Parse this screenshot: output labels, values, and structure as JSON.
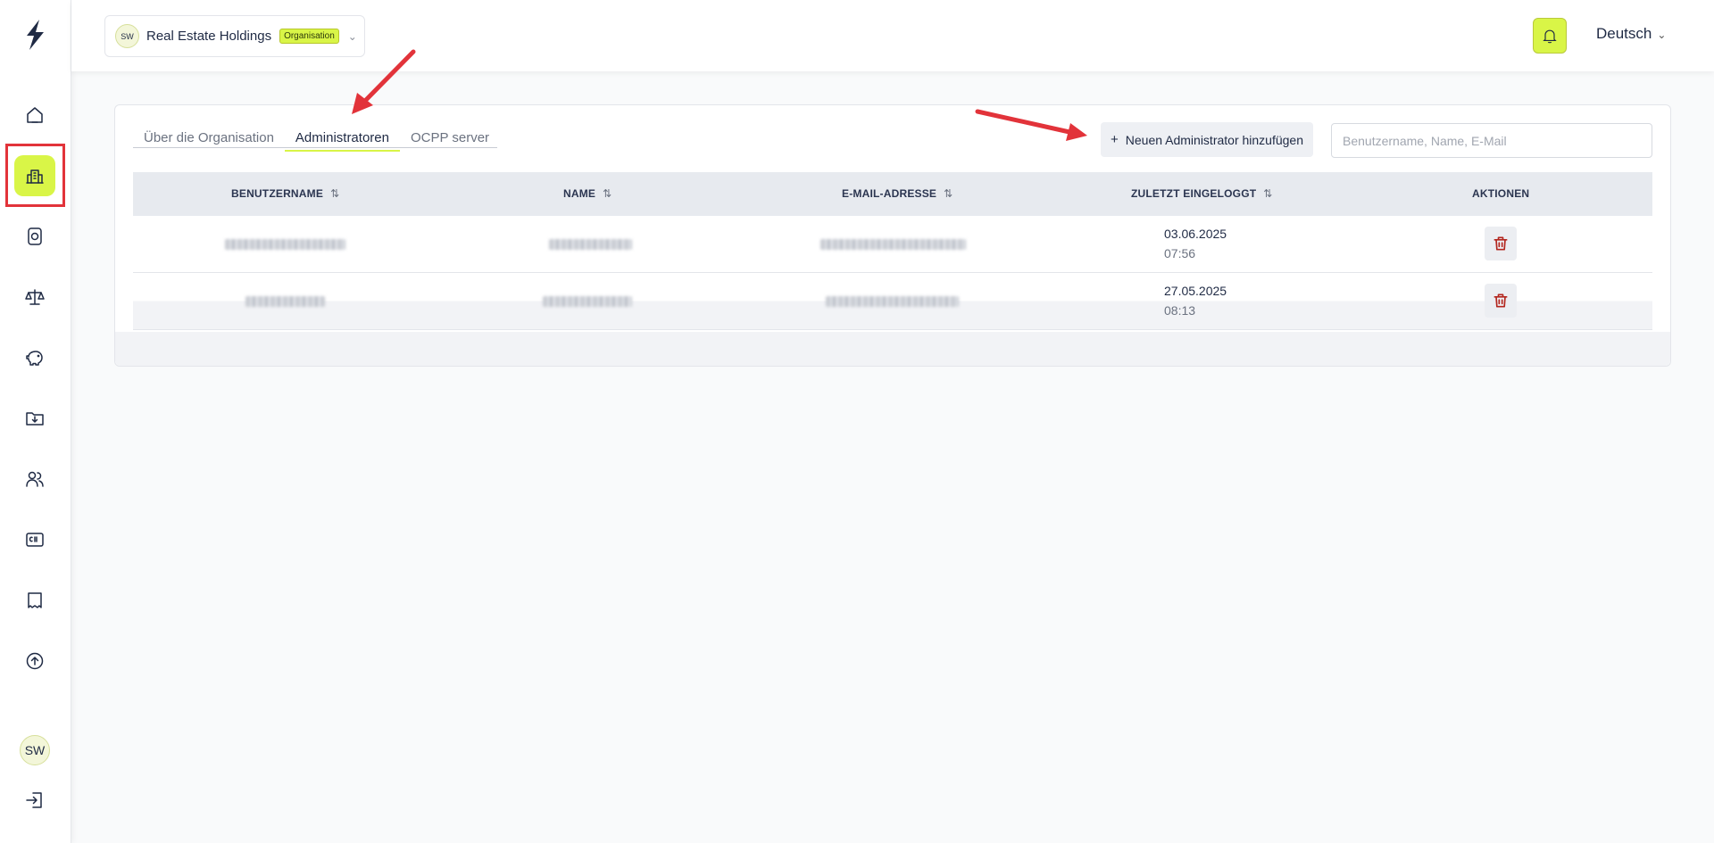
{
  "header": {
    "org_initials": "SW",
    "org_name": "Real Estate Holdings",
    "org_badge": "Organisation",
    "language": "Deutsch"
  },
  "sidebar": {
    "items": [
      {
        "icon": "home-icon"
      },
      {
        "icon": "building-icon",
        "active": true
      },
      {
        "icon": "charger-icon"
      },
      {
        "icon": "balance-scale-icon"
      },
      {
        "icon": "piggy-bank-icon"
      },
      {
        "icon": "folder-download-icon"
      },
      {
        "icon": "users-icon"
      },
      {
        "icon": "rfid-card-icon"
      },
      {
        "icon": "receipt-icon"
      },
      {
        "icon": "upload-circle-icon"
      }
    ],
    "user_initials": "SW"
  },
  "tabs": [
    {
      "label": "Über die Organisation",
      "active": false
    },
    {
      "label": "Administratoren",
      "active": true
    },
    {
      "label": "OCPP server",
      "active": false
    }
  ],
  "actions": {
    "add_label": "Neuen Administrator hinzufügen",
    "search_placeholder": "Benutzername, Name, E-Mail"
  },
  "table": {
    "columns": [
      "BENUTZERNAME",
      "NAME",
      "E-MAIL-ADRESSE",
      "ZULETZT EINGELOGGT",
      "AKTIONEN"
    ],
    "rows": [
      {
        "date": "03.06.2025",
        "time": "07:56"
      },
      {
        "date": "27.05.2025",
        "time": "08:13"
      }
    ]
  },
  "colors": {
    "accent": "#d9f547",
    "annotation": "#e2333a",
    "delete": "#b3261e"
  }
}
